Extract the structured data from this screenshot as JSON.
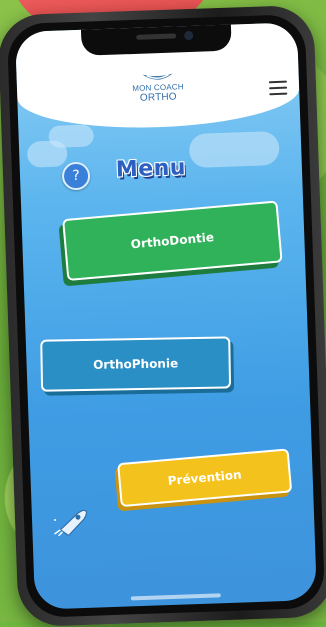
{
  "app": {
    "logo_line1": "MON COACH",
    "logo_line2": "ORTHO",
    "logo_icon": "smile-mouth-icon",
    "menu_icon": "hamburger-menu-icon"
  },
  "page": {
    "title": "Menu",
    "help_label": "?"
  },
  "menu": {
    "items": [
      {
        "label": "OrthoDontie",
        "color": "#2fb25a"
      },
      {
        "label": "OrthoPhonie",
        "color": "#2a8fc4"
      },
      {
        "label": "Prévention",
        "color": "#f4c21c"
      }
    ]
  },
  "decor": {
    "rocket_icon": "rocket-icon",
    "cloud_icon": "cloud-icon"
  }
}
